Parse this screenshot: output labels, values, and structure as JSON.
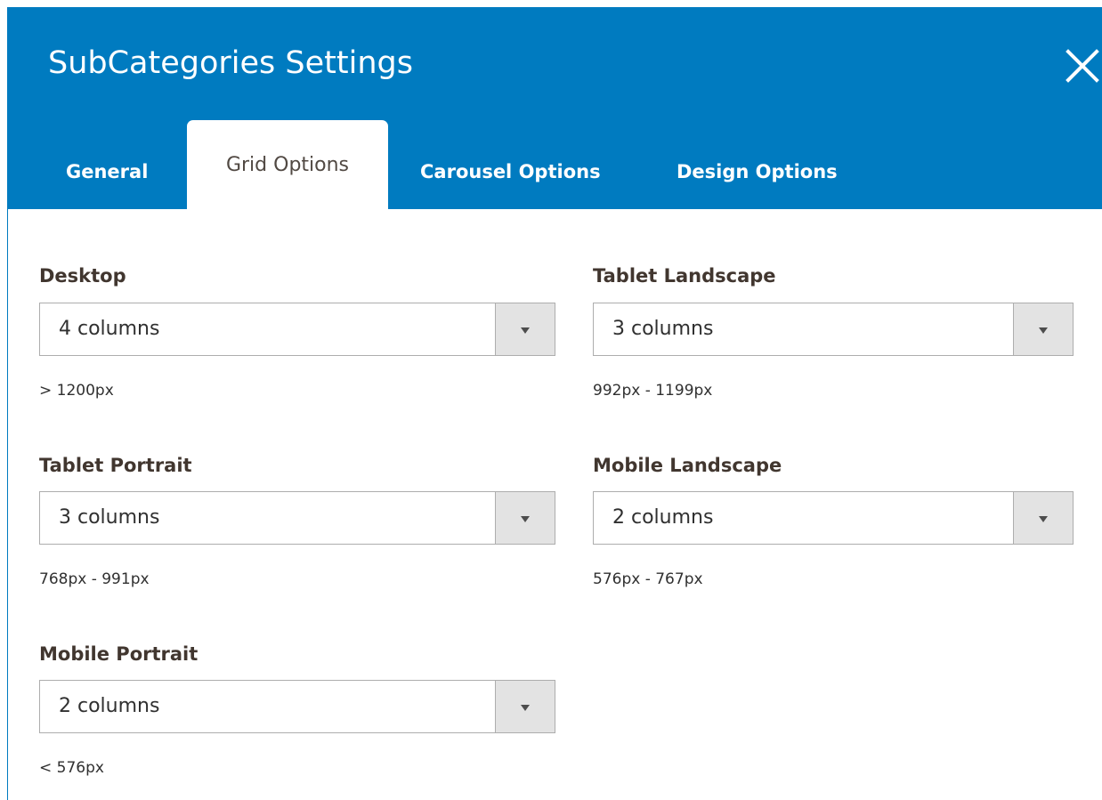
{
  "dialog": {
    "title": "SubCategories Settings",
    "close_icon": "close-icon",
    "colors": {
      "header_bg": "#007bc0",
      "tab_active_text": "#514943",
      "label_text": "#41362f",
      "select_border": "#adadad",
      "select_arrow_bg": "#e3e3e3"
    }
  },
  "tabs": [
    {
      "label": "General",
      "active": false
    },
    {
      "label": "Grid Options",
      "active": true
    },
    {
      "label": "Carousel Options",
      "active": false
    },
    {
      "label": "Design Options",
      "active": false
    }
  ],
  "fields": [
    {
      "label": "Desktop",
      "value": "4 columns",
      "note": "> 1200px"
    },
    {
      "label": "Tablet Landscape",
      "value": "3 columns",
      "note": "992px - 1199px"
    },
    {
      "label": "Tablet Portrait",
      "value": "3 columns",
      "note": "768px - 991px"
    },
    {
      "label": "Mobile Landscape",
      "value": "2 columns",
      "note": "576px - 767px"
    },
    {
      "label": "Mobile Portrait",
      "value": "2 columns",
      "note": "< 576px"
    }
  ],
  "icons": {
    "dropdown": "chevron-down-icon"
  }
}
